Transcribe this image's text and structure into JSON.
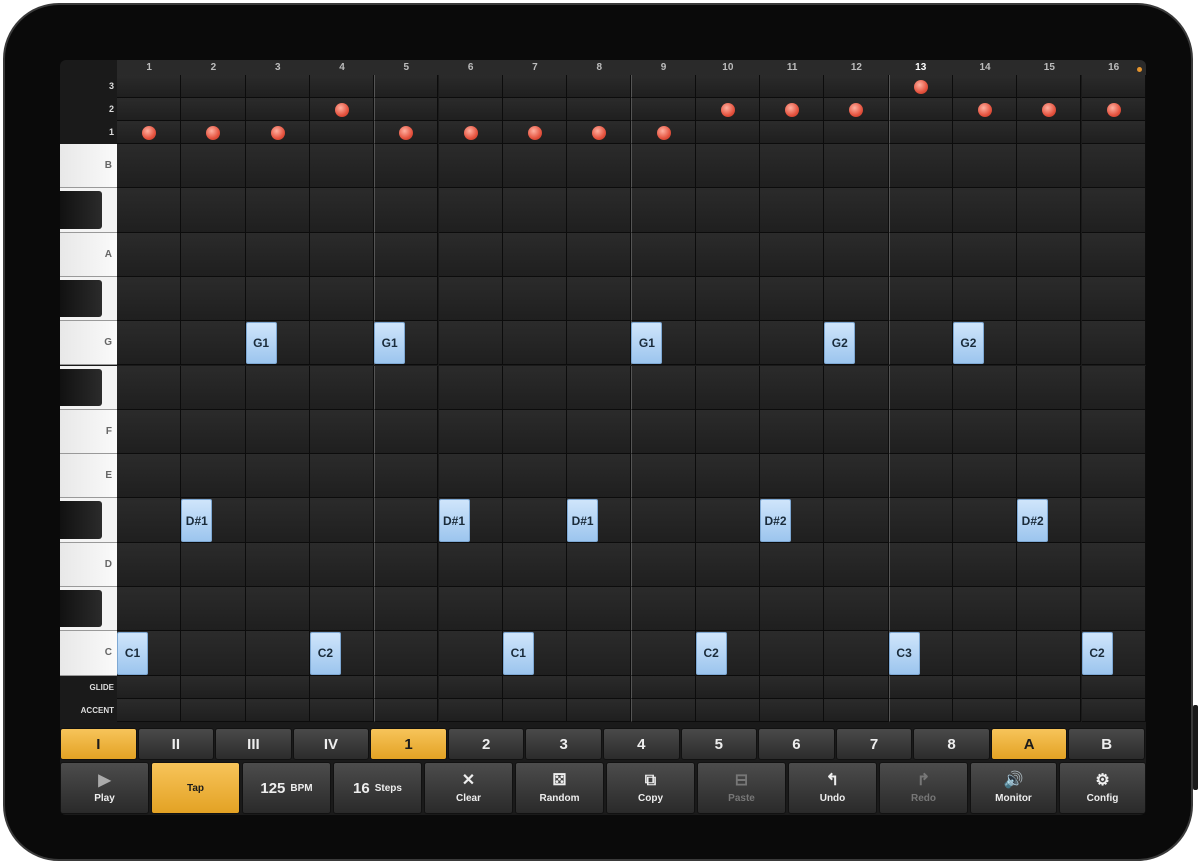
{
  "columns": [
    "1",
    "2",
    "3",
    "4",
    "5",
    "6",
    "7",
    "8",
    "9",
    "10",
    "11",
    "12",
    "13",
    "14",
    "15",
    "16"
  ],
  "active_column": "13",
  "octave_levels": [
    "3",
    "2",
    "1"
  ],
  "octave_dots": [
    {
      "col": 1,
      "level": 1
    },
    {
      "col": 2,
      "level": 1
    },
    {
      "col": 3,
      "level": 1
    },
    {
      "col": 4,
      "level": 2
    },
    {
      "col": 5,
      "level": 1
    },
    {
      "col": 6,
      "level": 1
    },
    {
      "col": 7,
      "level": 1
    },
    {
      "col": 8,
      "level": 1
    },
    {
      "col": 9,
      "level": 1
    },
    {
      "col": 10,
      "level": 2
    },
    {
      "col": 11,
      "level": 2
    },
    {
      "col": 12,
      "level": 2
    },
    {
      "col": 13,
      "level": 3
    },
    {
      "col": 14,
      "level": 2
    },
    {
      "col": 15,
      "level": 2
    },
    {
      "col": 16,
      "level": 2
    }
  ],
  "keys": [
    {
      "label": "B",
      "black": false
    },
    {
      "label": "",
      "black": true
    },
    {
      "label": "A",
      "black": false
    },
    {
      "label": "",
      "black": true
    },
    {
      "label": "G",
      "black": false
    },
    {
      "label": "",
      "black": true
    },
    {
      "label": "F",
      "black": false
    },
    {
      "label": "E",
      "black": false
    },
    {
      "label": "",
      "black": true
    },
    {
      "label": "D",
      "black": false
    },
    {
      "label": "",
      "black": true
    },
    {
      "label": "C",
      "black": false
    }
  ],
  "notes": [
    {
      "col": 3,
      "row": 4,
      "label": "G1"
    },
    {
      "col": 5,
      "row": 4,
      "label": "G1"
    },
    {
      "col": 9,
      "row": 4,
      "label": "G1"
    },
    {
      "col": 12,
      "row": 4,
      "label": "G2"
    },
    {
      "col": 14,
      "row": 4,
      "label": "G2"
    },
    {
      "col": 2,
      "row": 8,
      "label": "D#1"
    },
    {
      "col": 6,
      "row": 8,
      "label": "D#1"
    },
    {
      "col": 8,
      "row": 8,
      "label": "D#1"
    },
    {
      "col": 11,
      "row": 8,
      "label": "D#2"
    },
    {
      "col": 15,
      "row": 8,
      "label": "D#2"
    },
    {
      "col": 1,
      "row": 11,
      "label": "C1"
    },
    {
      "col": 4,
      "row": 11,
      "label": "C2"
    },
    {
      "col": 7,
      "row": 11,
      "label": "C1"
    },
    {
      "col": 10,
      "row": 11,
      "label": "C2"
    },
    {
      "col": 13,
      "row": 11,
      "label": "C3"
    },
    {
      "col": 16,
      "row": 11,
      "label": "C2"
    }
  ],
  "extra_rows": [
    "GLIDE",
    "ACCENT"
  ],
  "selectors": [
    {
      "label": "I",
      "active": true
    },
    {
      "label": "II",
      "active": false
    },
    {
      "label": "III",
      "active": false
    },
    {
      "label": "IV",
      "active": false
    },
    {
      "label": "1",
      "active": true
    },
    {
      "label": "2",
      "active": false
    },
    {
      "label": "3",
      "active": false
    },
    {
      "label": "4",
      "active": false
    },
    {
      "label": "5",
      "active": false
    },
    {
      "label": "6",
      "active": false
    },
    {
      "label": "7",
      "active": false
    },
    {
      "label": "8",
      "active": false
    },
    {
      "label": "A",
      "active": true
    },
    {
      "label": "B",
      "active": false
    }
  ],
  "toolbar": {
    "play": {
      "label": "Play",
      "icon": "play-icon",
      "glyph": "▶"
    },
    "tap": {
      "label": "Tap"
    },
    "bpm": {
      "value": "125",
      "unit": "BPM"
    },
    "steps": {
      "value": "16",
      "unit": "Steps"
    },
    "clear": {
      "label": "Clear",
      "icon": "close-icon",
      "glyph": "✕"
    },
    "random": {
      "label": "Random",
      "icon": "dice-icon",
      "glyph": "⚄"
    },
    "copy": {
      "label": "Copy",
      "icon": "copy-icon",
      "glyph": "⧉"
    },
    "paste": {
      "label": "Paste",
      "icon": "paste-icon",
      "glyph": "⊟"
    },
    "undo": {
      "label": "Undo",
      "icon": "undo-icon",
      "glyph": "↰"
    },
    "redo": {
      "label": "Redo",
      "icon": "redo-icon",
      "glyph": "↱"
    },
    "monitor": {
      "label": "Monitor",
      "icon": "speaker-icon",
      "glyph": "🔊"
    },
    "config": {
      "label": "Config",
      "icon": "gear-icon",
      "glyph": "⚙"
    }
  },
  "colors": {
    "accent": "#e3a224",
    "note": "#9cc5ee",
    "dot": "#e5533f"
  }
}
